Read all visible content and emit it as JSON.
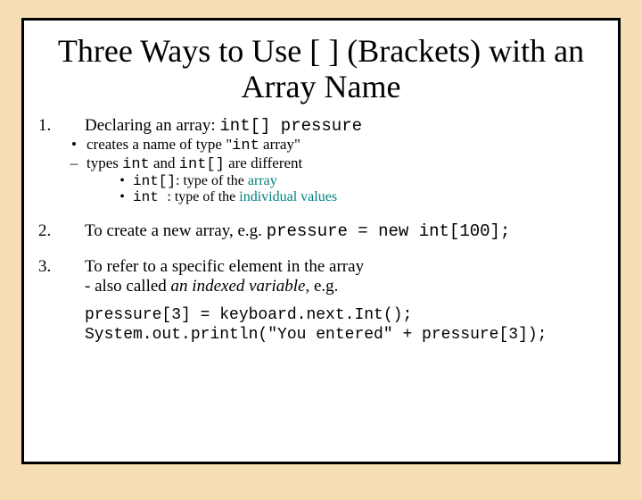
{
  "title": "Three Ways to Use [ ] (Brackets) with an Array Name",
  "items": [
    {
      "num": "1.",
      "line_a": "Declaring an array: ",
      "line_b_code": "int[] pressure",
      "sub": [
        {
          "bul": "•",
          "a": "creates a name of type \"",
          "b_code": "int",
          "c": " array\""
        },
        {
          "bul": "–",
          "a": "types ",
          "b_code": "int",
          "c": " and ",
          "d_code": "int[]",
          "e": " are different"
        }
      ],
      "subsub": [
        {
          "bul": "•",
          "code": "int[]",
          "plain": ": type of the ",
          "teal": "array"
        },
        {
          "bul": "•",
          "code": "int ",
          "plain": ": type of the ",
          "teal": "individual values"
        }
      ]
    },
    {
      "num": "2.",
      "a": "To create a new array, e.g. ",
      "b_code": "pressure = new int[100];"
    },
    {
      "num": "3.",
      "a": "To refer to a specific element in the array",
      "b": "- also called ",
      "b_em": "an indexed variable",
      "c": ", e.g.",
      "code1": "pressure[3] = keyboard.next.Int();",
      "code2": "System.out.println(\"You entered\" + pressure[3]);"
    }
  ]
}
